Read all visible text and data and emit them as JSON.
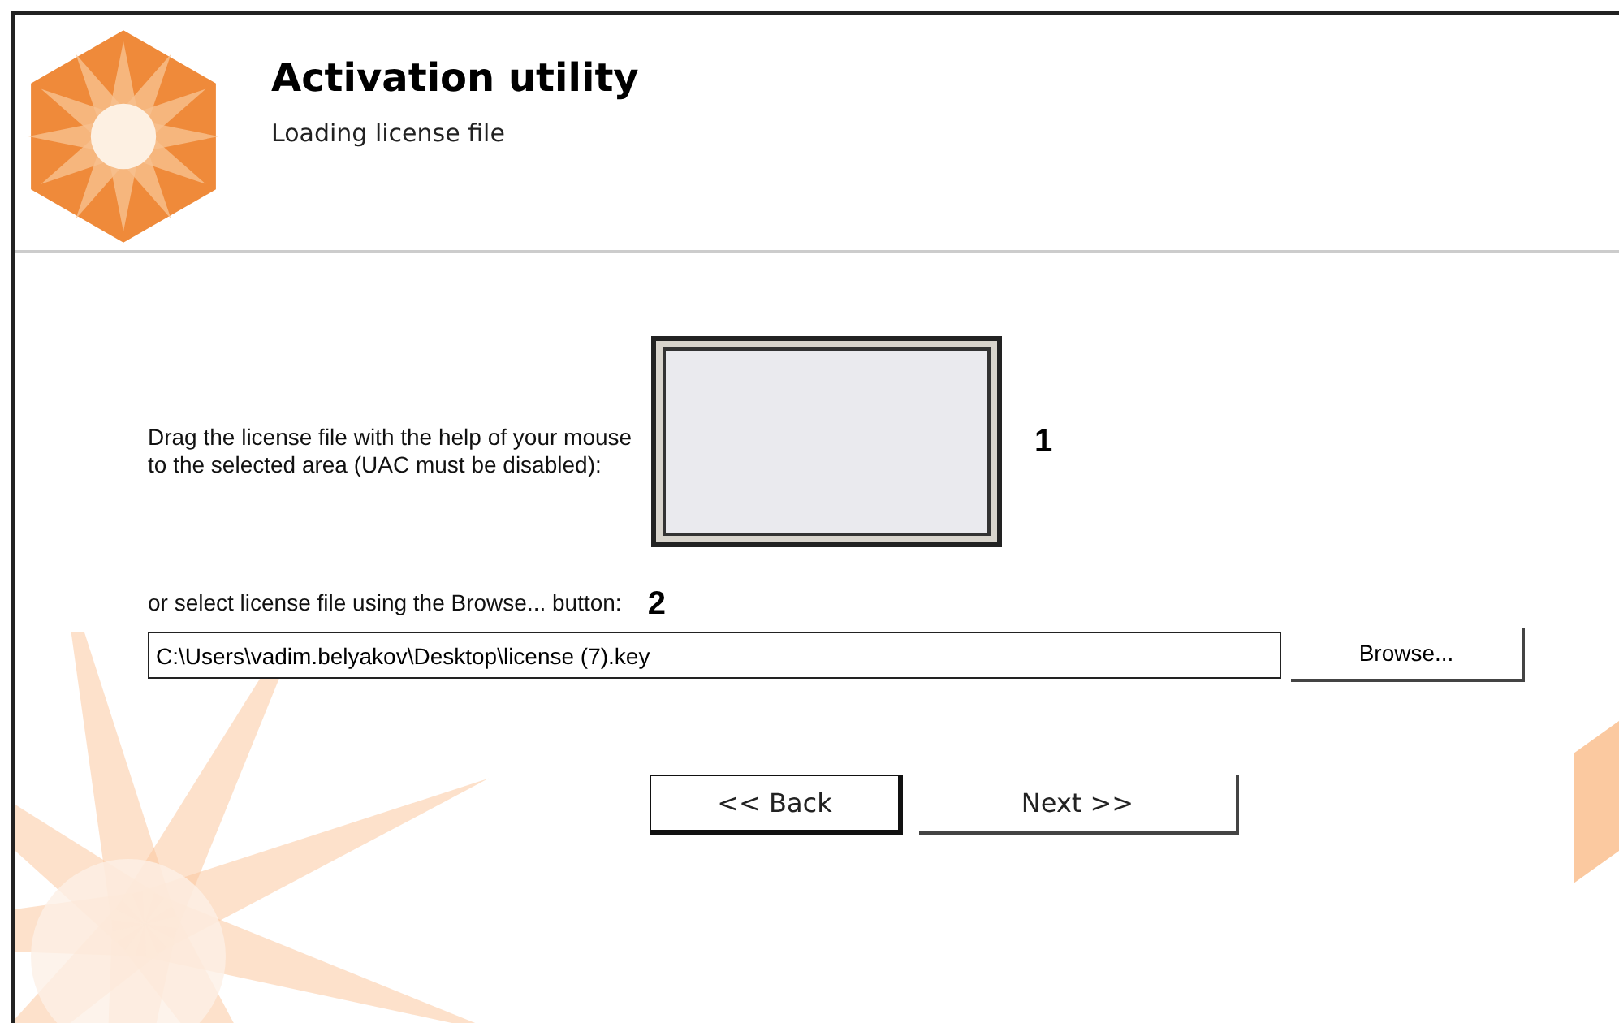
{
  "header": {
    "title": "Activation utility",
    "subtitle": "Loading license file"
  },
  "drag_area": {
    "instruction": "Drag the license file with the help of your mouse to the selected area (UAC must be disabled):",
    "callout": "1"
  },
  "file_select": {
    "instruction": "or select license file using the Browse... button:",
    "callout": "2",
    "path_value": "C:\\Users\\vadim.belyakov\\Desktop\\license (7).key",
    "browse_button": "Browse..."
  },
  "buttons": [
    {
      "label": "<< Back",
      "kind": "default"
    },
    {
      "label": "Next >>",
      "kind": "flat"
    }
  ]
}
